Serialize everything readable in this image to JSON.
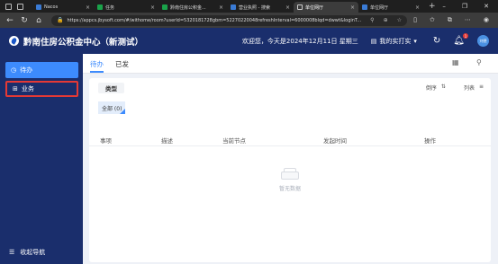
{
  "browser": {
    "tabs": [
      {
        "title": "Nacos",
        "active": false
      },
      {
        "title": "任务",
        "active": false
      },
      {
        "title": "黔南住房公积金...",
        "active": false
      },
      {
        "title": "营业执照 - 搜索",
        "active": false
      },
      {
        "title": "单位网厅",
        "active": true
      },
      {
        "title": "单位网厅",
        "active": false
      }
    ],
    "url": "https://appcs.jbysoft.com/#/withome/room?userId=5320181728gbm=52270220048refreshInterval=6000008blqd=dwwt&loginT..."
  },
  "header": {
    "app_title": "黔南住房公积金中心（新测试）",
    "welcome": "欢迎您，今天是2024年12月11日 星期三",
    "office": "我的实打实",
    "notification_count": "1",
    "avatar_text": "刘德"
  },
  "sidebar": {
    "items": [
      {
        "label": "待办",
        "icon": "clock-icon",
        "active": true
      },
      {
        "label": "业务",
        "icon": "grid-icon",
        "active": false
      }
    ],
    "collapse_label": "收起导航"
  },
  "main": {
    "tabs": [
      {
        "label": "待办",
        "active": true
      },
      {
        "label": "已发",
        "active": false
      }
    ],
    "filter": {
      "type_label": "类型",
      "sort_label": "倒序",
      "layout_label": "列表",
      "all_chip": "全部 (0)"
    },
    "table": {
      "columns": [
        "事项",
        "描述",
        "当前节点",
        "发起时间",
        "操作"
      ],
      "rows": [],
      "empty_text": "暂无数据"
    }
  },
  "colors": {
    "header_bg": "#1a2e6c",
    "accent": "#3d8bfd",
    "highlight_border": "#e53935"
  }
}
